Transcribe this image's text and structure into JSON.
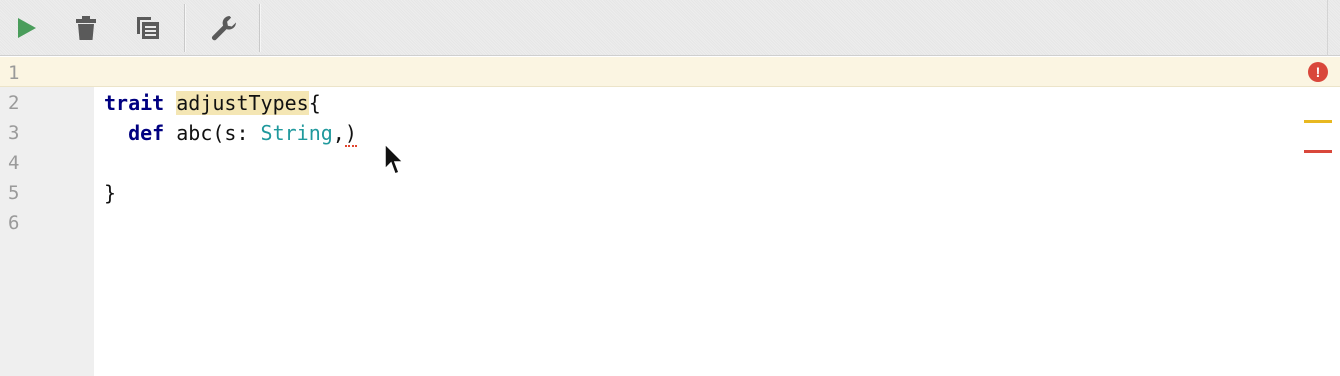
{
  "toolbar": {
    "buttons": [
      {
        "name": "run",
        "icon": "play-icon",
        "color": "#4a9d5b"
      },
      {
        "name": "clear",
        "icon": "trash-icon",
        "color": "#5a5a5a"
      },
      {
        "name": "copy",
        "icon": "copy-icon",
        "color": "#5a5a5a"
      },
      {
        "name": "settings",
        "icon": "wrench-icon",
        "color": "#5a5a5a"
      }
    ]
  },
  "editor": {
    "line_numbers": [
      "1",
      "2",
      "3",
      "4",
      "5",
      "6"
    ],
    "code": {
      "line2": {
        "keyword": "trait",
        "space": " ",
        "identifier": "adjustTypes",
        "brace": "{"
      },
      "line3": {
        "indent": "  ",
        "keyword": "def",
        "pre": " abc(s: ",
        "type": "String",
        "comma": ",",
        "paren": ")"
      },
      "line5": {
        "brace": "}"
      }
    },
    "error_badge": "!",
    "colors": {
      "keyword": "#000080",
      "type": "#20999d",
      "identifier_highlight": "#f4e6b4",
      "current_line": "#fbf5e2",
      "error": "#d9473b",
      "warning_stripe": "#e8b820",
      "error_stripe": "#d9473b"
    }
  }
}
